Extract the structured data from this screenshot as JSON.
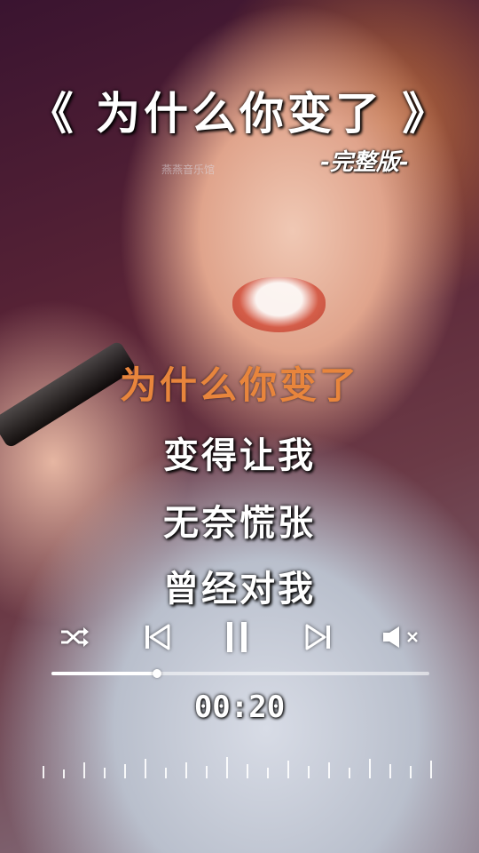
{
  "song": {
    "title": "《 为什么你变了 》",
    "version_label": "-完整版-",
    "watermark": "燕燕音乐馆"
  },
  "lyrics": {
    "current": "为什么你变了",
    "next1": "变得让我",
    "next2": "无奈慌张",
    "next3": "曾经对我"
  },
  "player": {
    "shuffle_icon": "shuffle-icon",
    "prev_icon": "skip-previous-icon",
    "pause_icon": "pause-icon",
    "next_icon": "skip-next-icon",
    "mute_icon": "volume-muted-icon",
    "progress_fraction": 0.28,
    "time": "00:20",
    "muted": true
  },
  "colors": {
    "active_lyric": "#e8853c",
    "text": "#ffffff"
  }
}
